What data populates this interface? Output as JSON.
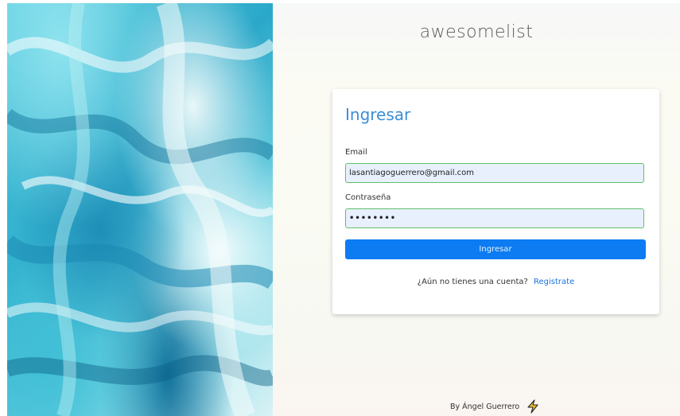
{
  "brand": {
    "name": "awesomelist"
  },
  "login": {
    "title": "Ingresar",
    "email_label": "Email",
    "email_value": "lasantiagoguerrero@gmail.com",
    "password_label": "Contraseña",
    "password_value": "••••••••",
    "submit_label": "Ingresar",
    "no_account_text": "¿Aún no tienes una cuenta?",
    "register_link": "Registrate"
  },
  "footer": {
    "credit": "By Ángel Guerrero",
    "icon": "lightning-bolt-icon"
  },
  "colors": {
    "accent": "#0d7cf2",
    "title": "#3b8ed6",
    "link": "#1a73e8",
    "input_border": "#5fbf6a",
    "input_bg": "#e8f0fe"
  }
}
